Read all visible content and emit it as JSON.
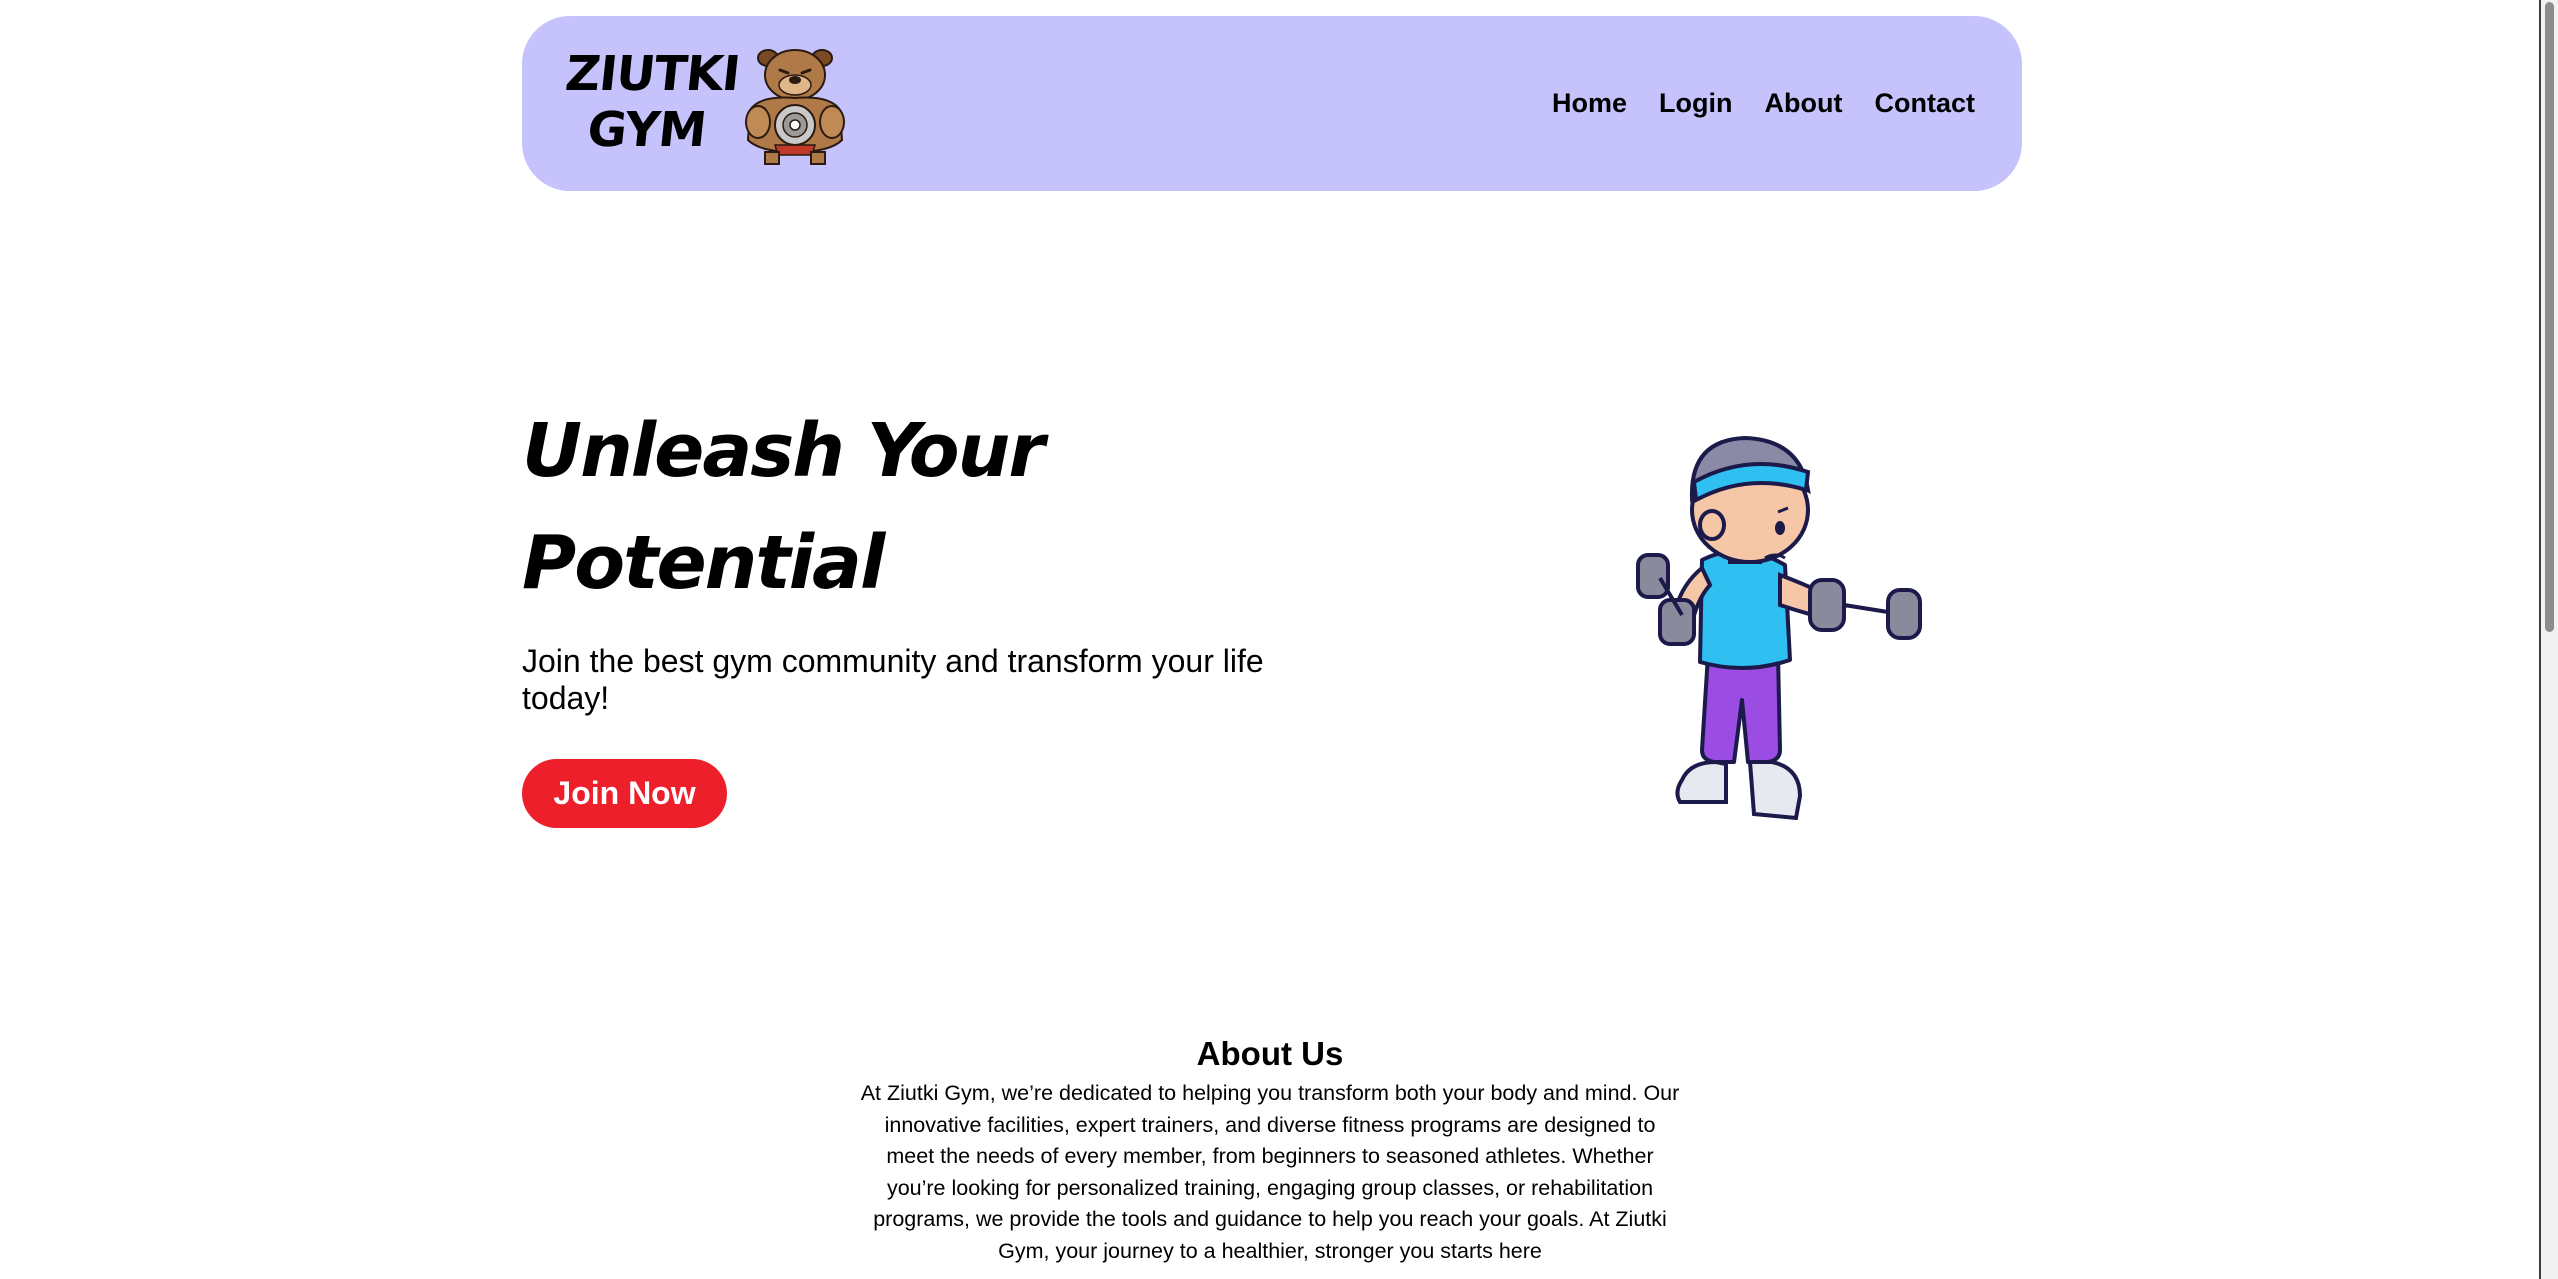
{
  "header": {
    "logo_line1": "ZIUTKI",
    "logo_line2": "GYM",
    "logo_icon": "bulldog-weightlifter-icon",
    "nav": [
      {
        "label": "Home"
      },
      {
        "label": "Login"
      },
      {
        "label": "About"
      },
      {
        "label": "Contact"
      }
    ]
  },
  "hero": {
    "title_line1": "Unleash Your",
    "title_line2": "Potential",
    "subtitle": "Join the best gym community and transform your life today!",
    "cta_label": "Join Now",
    "illustration": "boy-lifting-dumbbells-illustration"
  },
  "about": {
    "heading": "About Us",
    "body": "At Ziutki Gym, we’re dedicated to helping you transform both your body and mind. Our innovative facilities, expert trainers, and diverse fitness programs are designed to meet the needs of every member, from beginners to seasoned athletes. Whether you’re looking for personalized training, engaging group classes, or rehabilitation programs, we provide the tools and guidance to help you reach your goals. At Ziutki Gym, your journey to a healthier, stronger you starts here"
  },
  "colors": {
    "navbar_bg": "#c6c3fc",
    "cta_bg": "#ec1f2a",
    "cta_text": "#ffffff"
  }
}
